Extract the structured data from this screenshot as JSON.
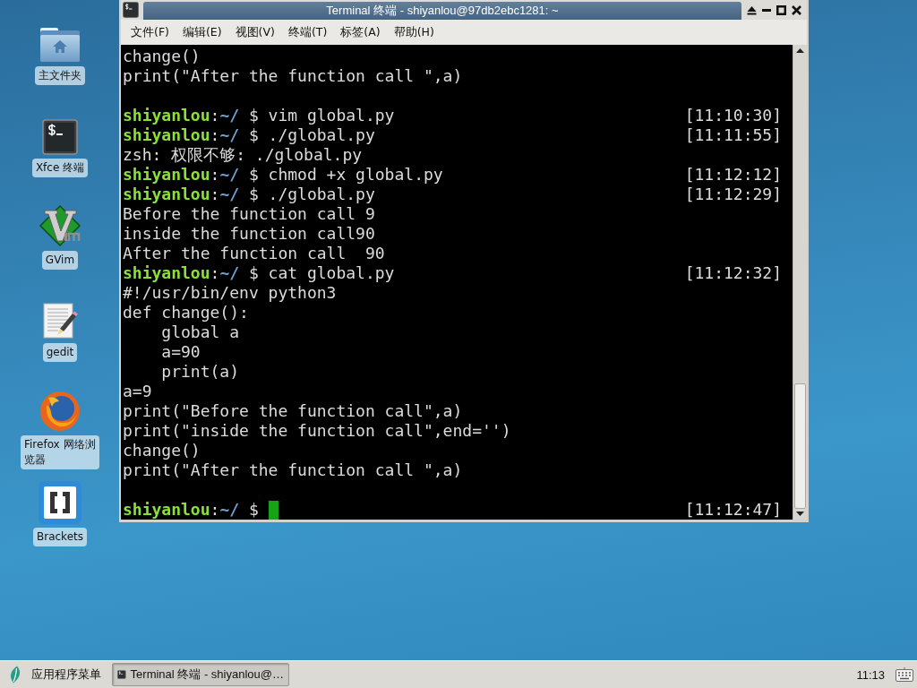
{
  "desktop": {
    "icons": [
      {
        "label": "主文件夹"
      },
      {
        "label": "Xfce 终端"
      },
      {
        "label": "GVim"
      },
      {
        "label": "gedit"
      },
      {
        "label": "Firefox 网络浏览器"
      },
      {
        "label": "Brackets"
      }
    ]
  },
  "window": {
    "title": "Terminal 终端 - shiyanlou@97db2ebc1281: ~",
    "menu": [
      "文件(F)",
      "编辑(E)",
      "视图(V)",
      "终端(T)",
      "标签(A)",
      "帮助(H)"
    ]
  },
  "terminal": {
    "lines": [
      {
        "kind": "output",
        "text": "change()"
      },
      {
        "kind": "output",
        "text": "print(\"After the function call \",a)"
      },
      {
        "kind": "blank"
      },
      {
        "kind": "prompt",
        "user": "shiyanlou",
        "separator": ":",
        "path": "~/",
        "symbol": "$",
        "command": "vim global.py",
        "time": "[11:10:30]",
        "cursor": false
      },
      {
        "kind": "prompt",
        "user": "shiyanlou",
        "separator": ":",
        "path": "~/",
        "symbol": "$",
        "command": "./global.py",
        "time": "[11:11:55]",
        "cursor": false
      },
      {
        "kind": "output",
        "text": "zsh: 权限不够: ./global.py"
      },
      {
        "kind": "prompt",
        "user": "shiyanlou",
        "separator": ":",
        "path": "~/",
        "symbol": "$",
        "command": "chmod +x global.py",
        "time": "[11:12:12]",
        "cursor": false
      },
      {
        "kind": "prompt",
        "user": "shiyanlou",
        "separator": ":",
        "path": "~/",
        "symbol": "$",
        "command": "./global.py",
        "time": "[11:12:29]",
        "cursor": false
      },
      {
        "kind": "output",
        "text": "Before the function call 9"
      },
      {
        "kind": "output",
        "text": "inside the function call90"
      },
      {
        "kind": "output",
        "text": "After the function call  90"
      },
      {
        "kind": "prompt",
        "user": "shiyanlou",
        "separator": ":",
        "path": "~/",
        "symbol": "$",
        "command": "cat global.py",
        "time": "[11:12:32]",
        "cursor": false
      },
      {
        "kind": "output",
        "text": "#!/usr/bin/env python3"
      },
      {
        "kind": "output",
        "text": "def change():"
      },
      {
        "kind": "output",
        "text": "    global a"
      },
      {
        "kind": "output",
        "text": "    a=90"
      },
      {
        "kind": "output",
        "text": "    print(a)"
      },
      {
        "kind": "output",
        "text": "a=9"
      },
      {
        "kind": "output",
        "text": "print(\"Before the function call\",a)"
      },
      {
        "kind": "output",
        "text": "print(\"inside the function call\",end='')"
      },
      {
        "kind": "output",
        "text": "change()"
      },
      {
        "kind": "output",
        "text": "print(\"After the function call \",a)"
      },
      {
        "kind": "blank"
      },
      {
        "kind": "prompt",
        "user": "shiyanlou",
        "separator": ":",
        "path": "~/",
        "symbol": "$",
        "time": "[11:12:47]",
        "cursor": true
      }
    ]
  },
  "taskbar": {
    "app_menu": "应用程序菜单",
    "tasks": [
      {
        "label": "Terminal 终端 - shiyanlou@…",
        "selected": true
      }
    ],
    "clock": "11:13"
  }
}
